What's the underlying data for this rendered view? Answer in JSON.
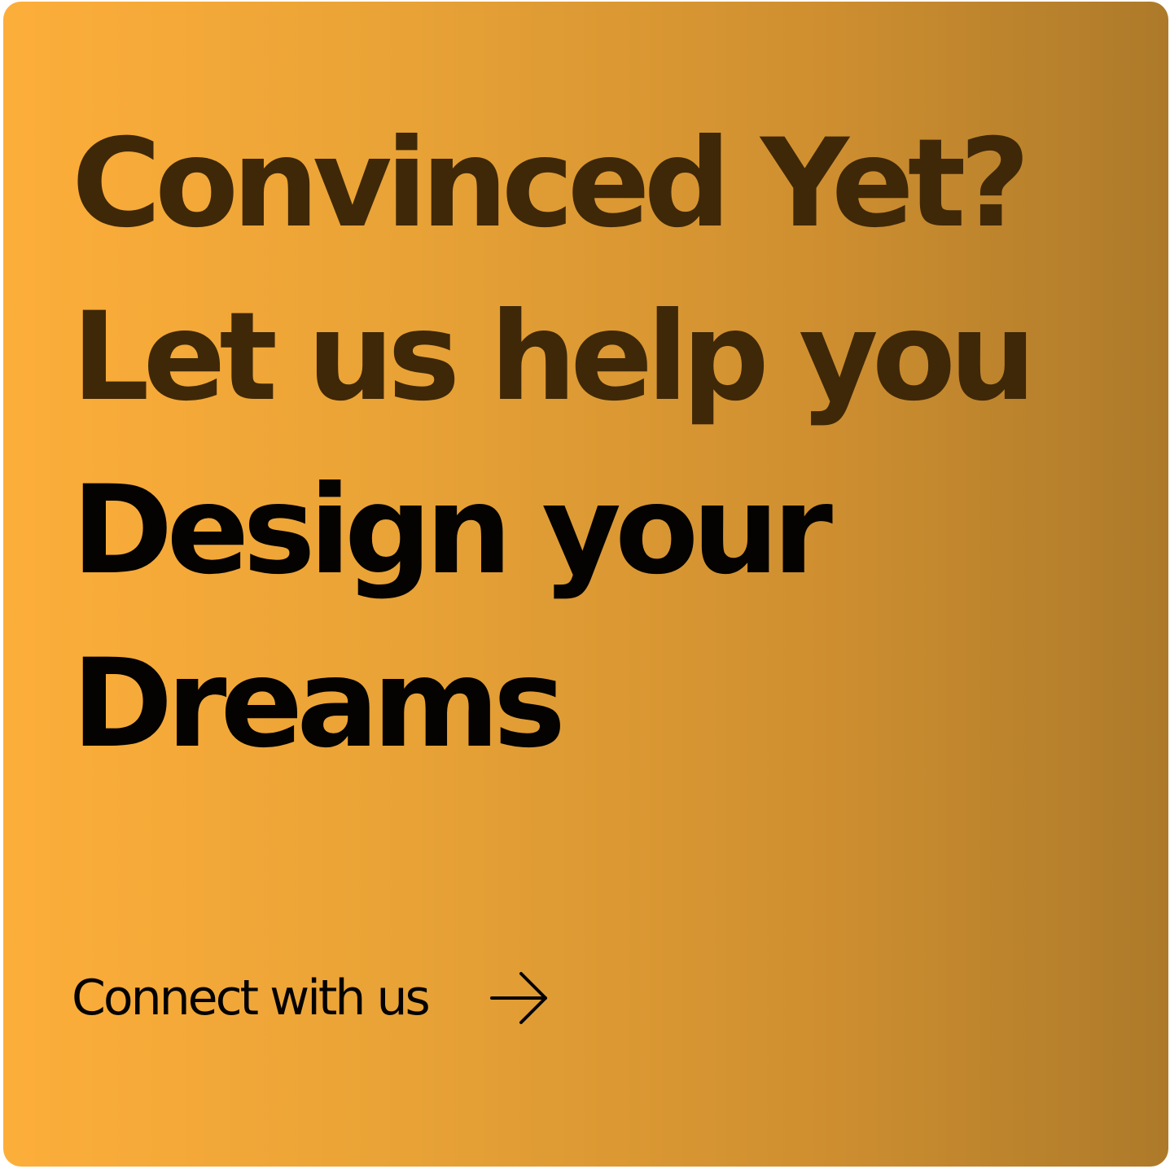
{
  "headline": {
    "line1": "Convinced Yet?",
    "line2": "Let us help you",
    "line3": "Design your",
    "line4": "Dreams"
  },
  "cta": {
    "label": "Connect with us",
    "icon": "arrow-right-icon"
  },
  "colors": {
    "gradient_start": "#fdae3a",
    "gradient_end": "#ad7a2a",
    "text_dim": "#3f2808",
    "text_strong": "#050301"
  }
}
